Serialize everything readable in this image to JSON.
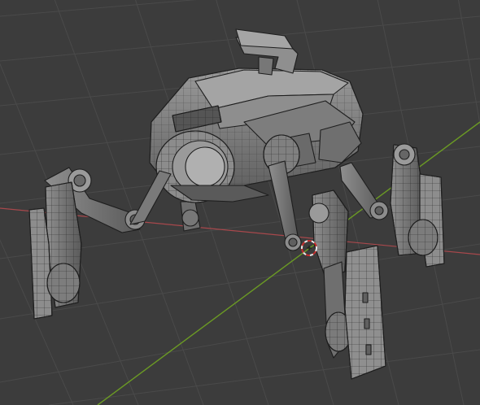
{
  "viewport": {
    "name": "3d-viewport",
    "background_color": "#3c3c3c",
    "grid_line_color": "#494949",
    "x_axis_color": "#a8484c",
    "y_axis_color": "#6b9a24",
    "mesh_fill_color": "#8a8a8a",
    "mesh_wire_color": "#1e1e1e",
    "cursor_icon": "3d-cursor-icon"
  },
  "model": {
    "type": "robot-walker-mesh",
    "shown": "wireframe-overlay"
  }
}
